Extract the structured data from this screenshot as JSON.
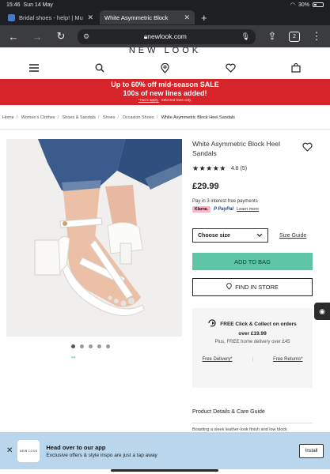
{
  "status_bar": {
    "time": "15:46",
    "date": "Sun 14 May",
    "battery": "30%"
  },
  "browser": {
    "tabs": [
      {
        "title": "Bridal shoes - help! | Mu",
        "active": false
      },
      {
        "title": "White Asymmetric Block",
        "active": true
      }
    ],
    "url": "newlook.com",
    "tab_count": "2"
  },
  "site": {
    "brand": "NEW LOOK",
    "promo": {
      "line1": "Up to 60% off mid-season SALE",
      "line2": "100s of new lines added!",
      "terms_link": "*T&Cs apply.",
      "terms_text": "Selected lines only."
    },
    "breadcrumbs": [
      "Home",
      "Women's Clothes",
      "Shoes & Sandals",
      "Shoes",
      "Occasion Shoes",
      "White Asymmetric Block Heel Sandals"
    ]
  },
  "product": {
    "title": "White Asymmetric Block Heel Sandals",
    "rating_value": 4.8,
    "rating_text": "4.8",
    "review_count": "(5)",
    "price": "£29.99",
    "pay_in_3": "Pay in 3 interest free payments",
    "klarna": "Klarna.",
    "paypal": "PayPal",
    "learn_more": "Learn more",
    "size_select": "Choose size",
    "size_guide": "Size Guide",
    "add_to_bag": "ADD TO BAG",
    "find_in_store": "FIND IN STORE",
    "image_count": 5,
    "active_image": 0
  },
  "delivery": {
    "line1": "FREE Click & Collect on orders",
    "line2": "over £19.99",
    "line3": "Plus, FREE home delivery over £45",
    "free_delivery": "Free Delivery*",
    "free_returns": "Free Returns*"
  },
  "details": {
    "heading": "Product Details & Care Guide",
    "peek": "Boasting a sleek leather-look finish and low block"
  },
  "app_banner": {
    "logo": "NEW LOOK",
    "title": "Head over to our app",
    "subtitle": "Exclusive offers & style inspo are just a tap away",
    "install": "Install"
  },
  "colors": {
    "promo": "#d7232a",
    "add_to_bag": "#5ec6a6",
    "app_banner": "#b9d6ec"
  }
}
